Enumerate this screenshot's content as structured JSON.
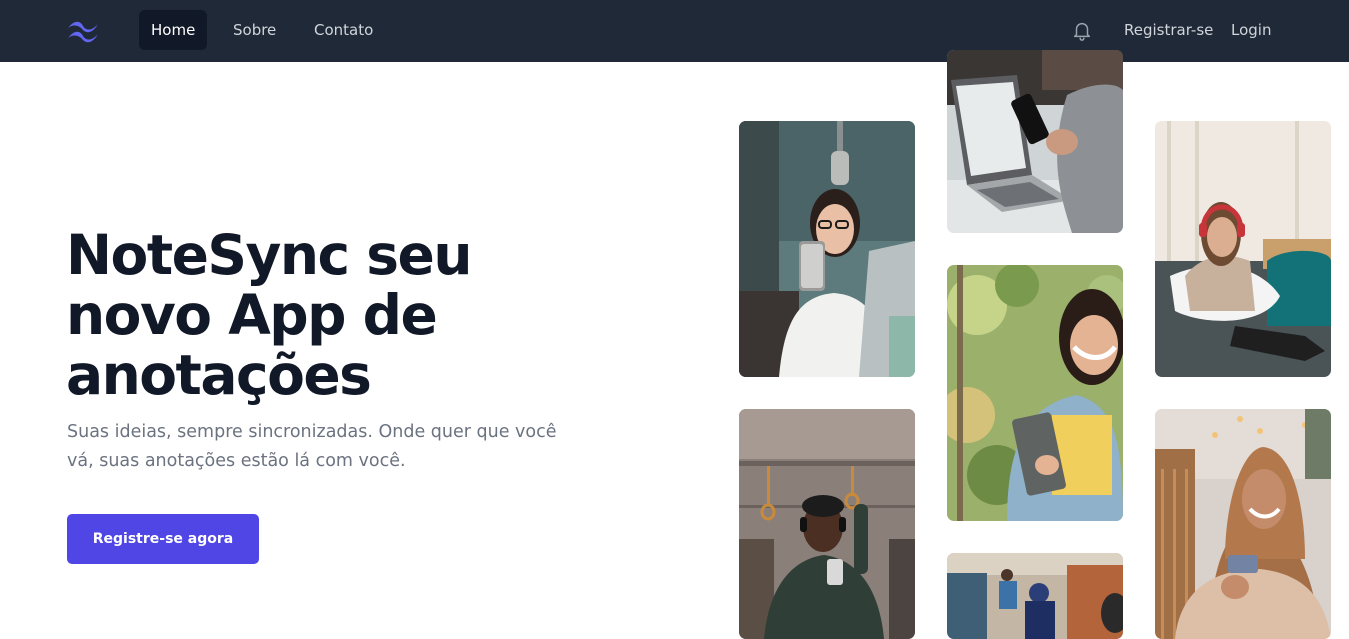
{
  "nav": {
    "logo_icon": "tailwind-waves-icon",
    "links": [
      {
        "label": "Home",
        "active": true
      },
      {
        "label": "Sobre",
        "active": false
      },
      {
        "label": "Contato",
        "active": false
      }
    ],
    "notification_icon": "bell-icon",
    "register_label": "Registrar-se",
    "login_label": "Login"
  },
  "hero": {
    "title_lines": [
      "NoteSync seu",
      "novo App de",
      "anotações"
    ],
    "subtitle_lines": [
      "Suas ideias, sempre sincronizadas. Onde quer que você",
      "vá, suas anotações estão lá com você."
    ],
    "cta_label": "Registre-se agora"
  },
  "colors": {
    "navbar_bg": "#1f2937",
    "active_link_bg": "#111827",
    "brand": "#4f46e5",
    "logo": "#6366f1",
    "title": "#111827",
    "subtitle": "#6b7280"
  },
  "photos": [
    "woman-glasses-phone-office-photo",
    "laptop-phone-hands-photo",
    "woman-headphones-sofa-photo",
    "man-headphones-train-photo",
    "woman-smiling-tablet-photo",
    "woman-hijab-phone-photo",
    "office-people-photo"
  ]
}
